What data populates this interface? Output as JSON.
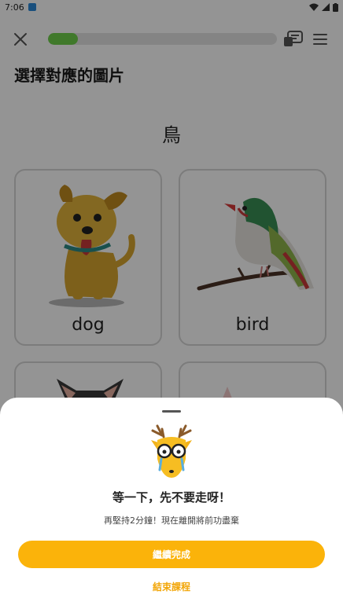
{
  "status_bar": {
    "time": "7:06"
  },
  "header": {
    "progress_percent": 13
  },
  "question": {
    "title": "選擇對應的圖片",
    "prompt": "鳥"
  },
  "options": [
    {
      "label": "dog",
      "image": "dog-picture"
    },
    {
      "label": "bird",
      "image": "bird-picture"
    },
    {
      "label": "",
      "image": "cat-picture"
    },
    {
      "label": "",
      "image": "animal-picture"
    }
  ],
  "dialog": {
    "title": "等一下，先不要走呀！",
    "message": "再堅持2分鐘！現在離開將前功盡棄",
    "continue_label": "繼續完成",
    "end_label": "結束課程"
  },
  "colors": {
    "accent": "#fbb30a",
    "progress": "#6fd04a"
  }
}
